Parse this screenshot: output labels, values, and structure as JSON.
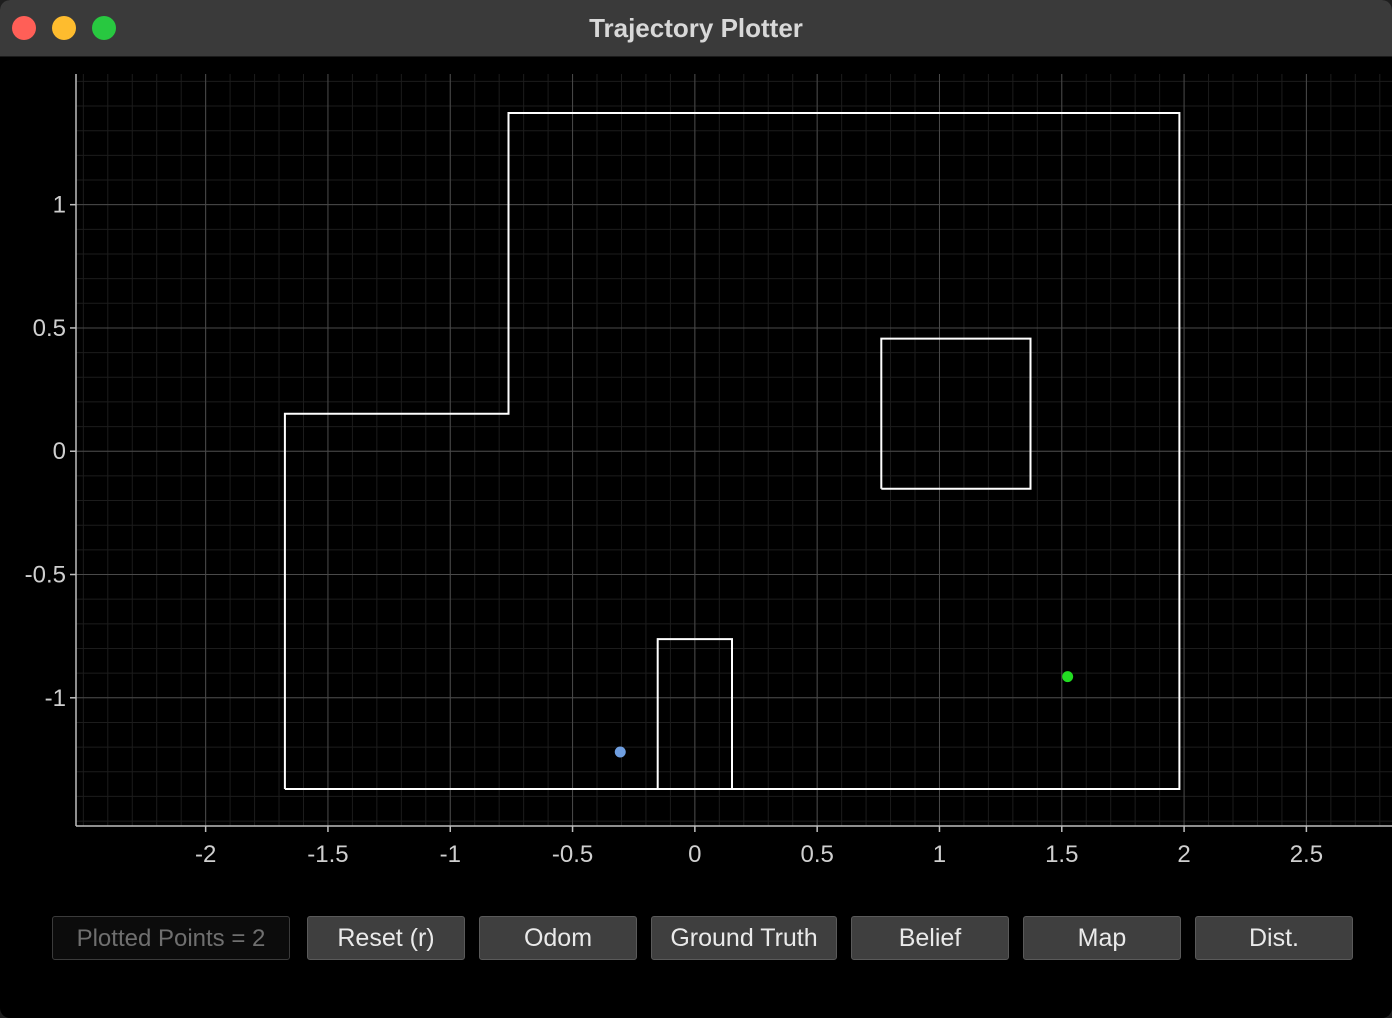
{
  "window": {
    "title": "Trajectory Plotter"
  },
  "status": {
    "plotted_points": "Plotted Points = 2"
  },
  "toolbar": {
    "reset_label": "Reset (r)",
    "odom_label": "Odom",
    "ground_truth_label": "Ground Truth",
    "belief_label": "Belief",
    "map_label": "Map",
    "dist_label": "Dist."
  },
  "colors": {
    "background": "#000000",
    "map_lines": "#ffffff",
    "belief_point": "#6f9ee0",
    "ground_truth_point": "#22dd22",
    "major_grid": "#4a4a4a",
    "minor_grid": "#1c1c1c"
  },
  "chart_data": {
    "type": "scatter",
    "xlim": [
      -2.53,
      2.85
    ],
    "ylim": [
      -1.52,
      1.53
    ],
    "xticks": [
      -2,
      -1.5,
      -1,
      -0.5,
      0,
      0.5,
      1,
      1.5,
      2,
      2.5
    ],
    "yticks": [
      -1,
      -0.5,
      0,
      0.5,
      1
    ],
    "xtick_labels": [
      "-2",
      "-1.5",
      "-1",
      "-0.5",
      "0",
      "0.5",
      "1",
      "1.5",
      "2",
      "2.5"
    ],
    "ytick_labels": [
      "-1",
      "-0.5",
      "0",
      "0.5",
      "1"
    ],
    "grid": true,
    "map_polylines": [
      [
        [
          -1.676,
          -1.37
        ],
        [
          1.981,
          -1.37
        ],
        [
          1.981,
          1.372
        ],
        [
          -0.762,
          1.372
        ],
        [
          -0.762,
          0.152
        ],
        [
          -1.676,
          0.152
        ],
        [
          -1.676,
          -1.37
        ]
      ],
      [
        [
          0.762,
          -0.152
        ],
        [
          1.372,
          -0.152
        ],
        [
          1.372,
          0.457
        ],
        [
          0.762,
          0.457
        ],
        [
          0.762,
          -0.152
        ]
      ],
      [
        [
          -0.152,
          -1.37
        ],
        [
          -0.152,
          -0.762
        ],
        [
          0.152,
          -0.762
        ],
        [
          0.152,
          -1.37
        ]
      ]
    ],
    "points": [
      {
        "x": -0.305,
        "y": -1.22,
        "color": "#6f9ee0"
      },
      {
        "x": 1.524,
        "y": -0.914,
        "color": "#22dd22"
      }
    ]
  }
}
